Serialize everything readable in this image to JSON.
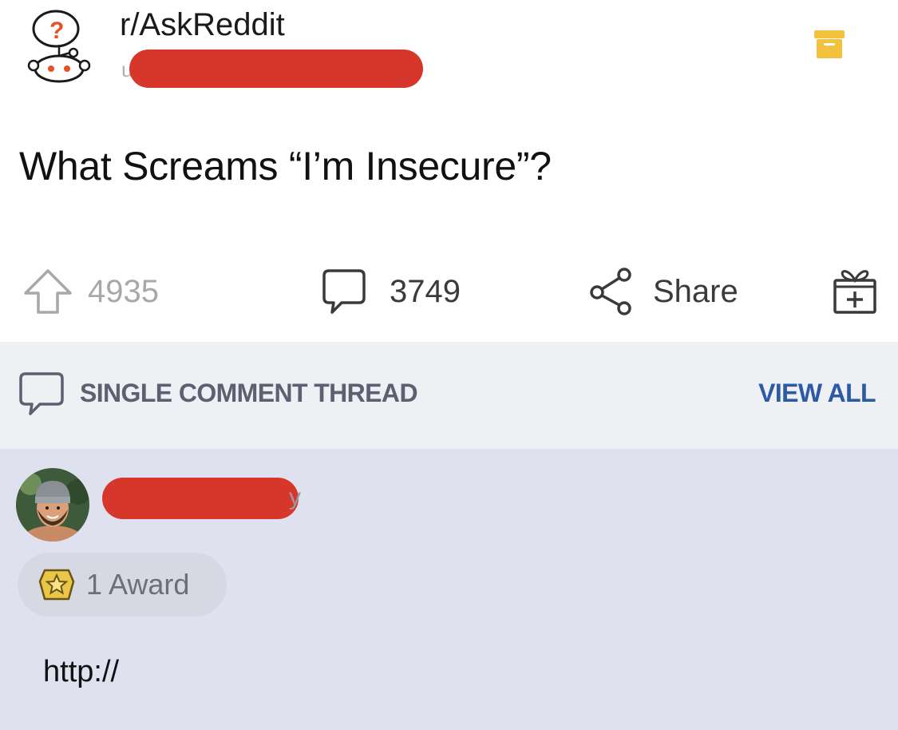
{
  "post": {
    "subreddit": "r/AskReddit",
    "user_prefix": "u",
    "title": "What Screams “I’m Insecure”?",
    "upvotes": "4935",
    "comments": "3749",
    "share_label": "Share"
  },
  "thread": {
    "label": "SINGLE COMMENT THREAD",
    "view_all": "VIEW ALL"
  },
  "comment": {
    "author_tail": "y",
    "award_label": "1 Award",
    "body": "http://"
  },
  "colors": {
    "redaction": "#d7372b",
    "archive_icon": "#f2c23c",
    "view_all_link": "#2d5aa4",
    "thread_bar_bg": "#eef0f4",
    "comment_bg": "#dfe2ee"
  },
  "icons": [
    "subreddit-avatar",
    "archive-icon",
    "upvote-icon",
    "comment-icon",
    "share-icon",
    "gift-award-icon",
    "comment-thread-icon",
    "award-badge-icon"
  ]
}
